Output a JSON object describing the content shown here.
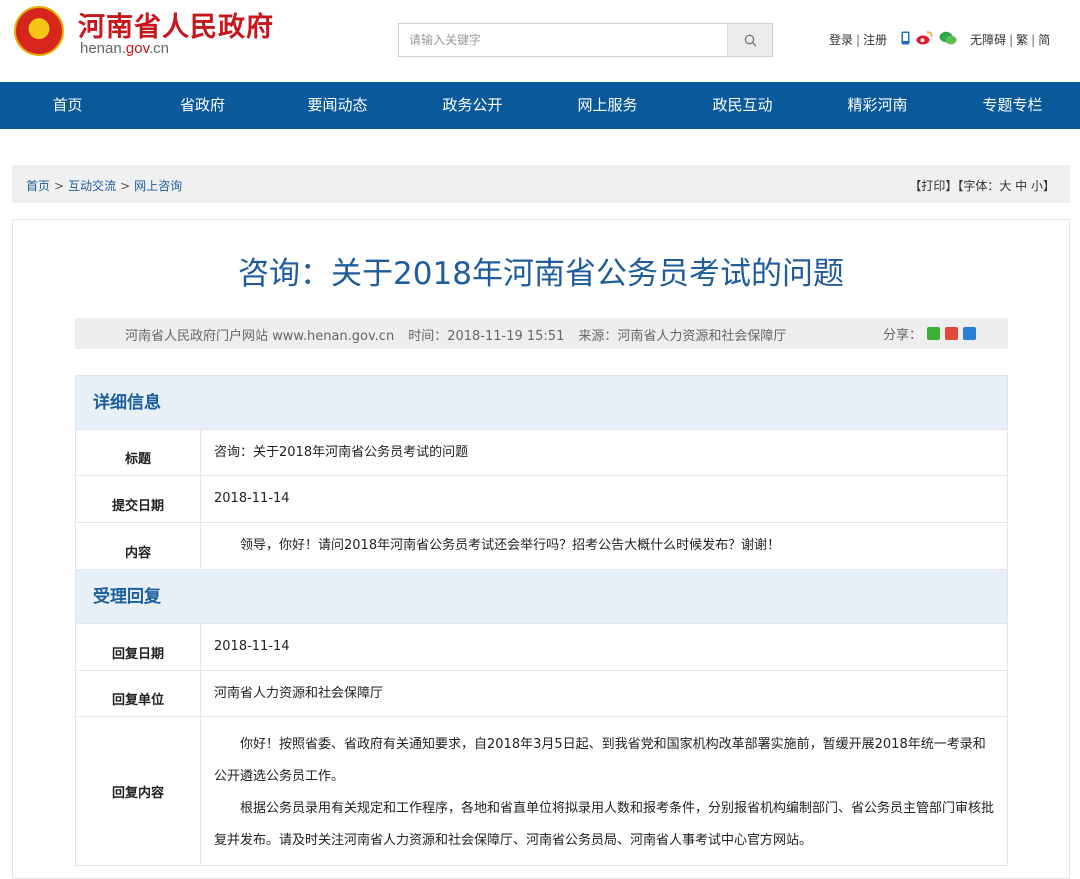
{
  "header": {
    "site_title": "河南省人民政府",
    "site_domain_prefix": "henan.",
    "site_domain_gov": "gov",
    "site_domain_suffix": ".cn",
    "search_placeholder": "请输入关键字",
    "login": "登录",
    "register": "注册",
    "accessible": "无障碍",
    "traditional": "繁",
    "simplified": "简",
    "separator": "|"
  },
  "nav": {
    "items": [
      "首页",
      "省政府",
      "要闻动态",
      "政务公开",
      "网上服务",
      "政民互动",
      "精彩河南",
      "专题专栏"
    ]
  },
  "breadcrumb": {
    "home": "首页",
    "level1": "互动交流",
    "level2": "网上咨询",
    "gt": ">",
    "tools": "【打印】【字体：大 中 小】"
  },
  "article": {
    "title": "咨询：关于2018年河南省公务员考试的问题",
    "site_info": "河南省人民政府门户网站 www.henan.gov.cn",
    "time": "时间：2018-11-19 15:51",
    "source": "来源：河南省人力资源和社会保障厅",
    "share_label": "分享："
  },
  "details": {
    "heading": "详细信息",
    "title_label": "标题",
    "title_value": "咨询：关于2018年河南省公务员考试的问题",
    "date_label": "提交日期",
    "date_value": "2018-11-14",
    "content_label": "内容",
    "content_value": "领导，你好！请问2018年河南省公务员考试还会举行吗？招考公告大概什么时候发布？谢谢！"
  },
  "reply": {
    "heading": "受理回复",
    "date_label": "回复日期",
    "date_value": "2018-11-14",
    "unit_label": "回复单位",
    "unit_value": "河南省人力资源和社会保障厅",
    "content_label": "回复内容",
    "paragraph1": "你好！按照省委、省政府有关通知要求，自2018年3月5日起、到我省党和国家机构改革部署实施前，暂缓开展2018年统一考录和公开遴选公务员工作。",
    "paragraph2": "根据公务员录用有关规定和工作程序，各地和省直单位将拟录用人数和报考条件，分别报省机构编制部门、省公务员主管部门审核批复并发布。请及时关注河南省人力资源和社会保障厅、河南省公务员局、河南省人事考试中心官方网站。"
  },
  "colors": {
    "brand_red": "#c8161d",
    "nav_blue": "#0a5a9b",
    "title_blue": "#1f5c9c",
    "section_bg": "#e8f0f7"
  },
  "icons": [
    "emblem-logo",
    "search-icon",
    "mobile-icon",
    "weibo-icon",
    "wechat-icon",
    "share-wechat-icon",
    "share-weibo-icon",
    "share-qq-icon"
  ]
}
